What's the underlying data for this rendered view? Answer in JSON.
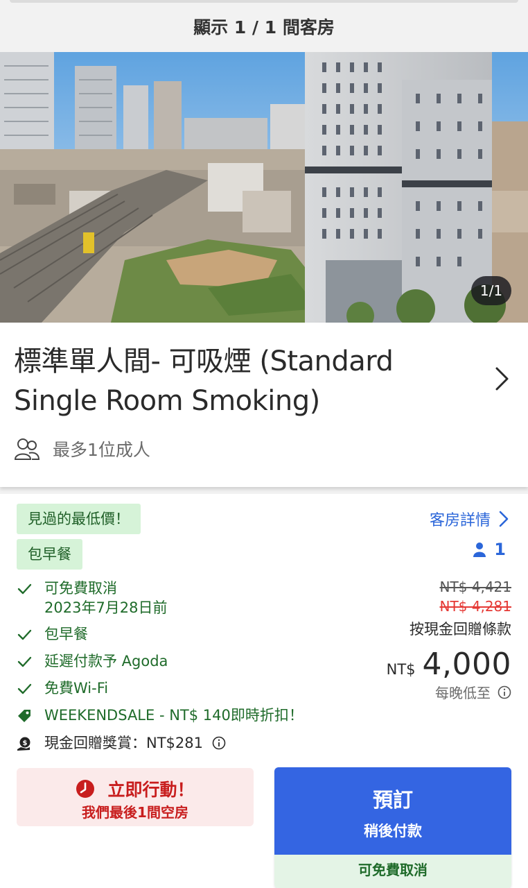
{
  "header": {
    "room_count_text": "顯示 1 / 1 間客房"
  },
  "photo": {
    "counter": "1/1"
  },
  "room": {
    "title": "標準單人間- 可吸煙 (Standard Single Room Smoking)",
    "occupancy": "最多1位成人",
    "icons": {
      "occupancy": "people-icon",
      "chevron": "chevron-right-icon"
    }
  },
  "offer": {
    "badges": {
      "lowest_price": "見過的最低價！",
      "breakfast": "包早餐"
    },
    "room_details_link": "客房詳情",
    "occupancy_count": "1",
    "features": {
      "free_cancel": "可免費取消",
      "free_cancel_date": "2023年7月28日前",
      "breakfast": "包早餐",
      "pay_later": "延遲付款予 Agoda",
      "wifi": "免費Wi-Fi",
      "promo": "WEEKENDSALE - NT$ 140即時折扣！",
      "cashback": "現金回贈獎賞：NT$281"
    },
    "prices": {
      "original": "NT$ 4,421",
      "discounted": "NT$ 4,281",
      "cashback_terms": "按現金回贈條款",
      "currency": "NT$",
      "final": "4,000",
      "per_night": "每晚低至"
    },
    "urgency": {
      "title": "立即行動！",
      "subtitle": "我們最後1間空房"
    },
    "book_button": {
      "label": "預訂",
      "sublabel": "稍後付款",
      "footer": "可免費取消"
    },
    "colors": {
      "green": "#1f6b2a",
      "blue": "#3465e2",
      "red": "#c81e1e",
      "link": "#2b66d9"
    }
  }
}
